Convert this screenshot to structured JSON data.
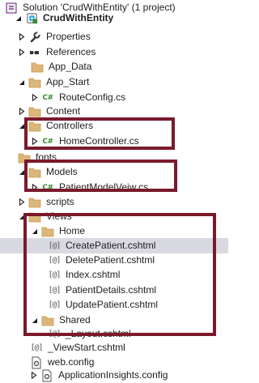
{
  "solution_explorer": {
    "nodes": [
      {
        "id": "solution",
        "label": "Solution 'CrudWithEntity' (1 project)",
        "icon": "solution-icon",
        "expander": "none",
        "bold": false,
        "selected": false
      },
      {
        "id": "project",
        "label": "CrudWithEntity",
        "icon": "web-project-icon",
        "expander": "expanded",
        "bold": true,
        "selected": false
      },
      {
        "id": "properties",
        "label": "Properties",
        "icon": "wrench-icon",
        "expander": "collapsed",
        "bold": false,
        "selected": false
      },
      {
        "id": "references",
        "label": "References",
        "icon": "references-icon",
        "expander": "collapsed",
        "bold": false,
        "selected": false
      },
      {
        "id": "app-data",
        "label": "App_Data",
        "icon": "folder-icon",
        "expander": "none",
        "bold": false,
        "selected": false
      },
      {
        "id": "app-start",
        "label": "App_Start",
        "icon": "folder-icon",
        "expander": "expanded",
        "bold": false,
        "selected": false
      },
      {
        "id": "routeconfig",
        "label": "RouteConfig.cs",
        "icon": "csharp-file-icon",
        "expander": "collapsed",
        "bold": false,
        "selected": false
      },
      {
        "id": "content",
        "label": "Content",
        "icon": "folder-icon",
        "expander": "collapsed",
        "bold": false,
        "selected": false
      },
      {
        "id": "controllers",
        "label": "Controllers",
        "icon": "folder-icon",
        "expander": "expanded",
        "bold": false,
        "selected": false
      },
      {
        "id": "homecontroller",
        "label": "HomeController.cs",
        "icon": "csharp-file-icon",
        "expander": "collapsed",
        "bold": false,
        "selected": false
      },
      {
        "id": "fonts",
        "label": "fonts",
        "icon": "folder-icon",
        "expander": "none",
        "bold": false,
        "selected": false
      },
      {
        "id": "models",
        "label": "Models",
        "icon": "folder-icon",
        "expander": "expanded",
        "bold": false,
        "selected": false
      },
      {
        "id": "patientmodelveiw",
        "label": "PatientModelVeiw.cs",
        "icon": "csharp-file-icon",
        "expander": "collapsed",
        "bold": false,
        "selected": false
      },
      {
        "id": "scripts",
        "label": "scripts",
        "icon": "folder-icon",
        "expander": "collapsed",
        "bold": false,
        "selected": false
      },
      {
        "id": "views",
        "label": "Views",
        "icon": "folder-icon",
        "expander": "expanded",
        "bold": false,
        "selected": false
      },
      {
        "id": "home",
        "label": "Home",
        "icon": "folder-icon",
        "expander": "expanded",
        "bold": false,
        "selected": false
      },
      {
        "id": "createpatient",
        "label": "CreatePatient.cshtml",
        "icon": "razor-file-icon",
        "expander": "none",
        "bold": false,
        "selected": true
      },
      {
        "id": "deletepatient",
        "label": "DeletePatient.cshtml",
        "icon": "razor-file-icon",
        "expander": "none",
        "bold": false,
        "selected": false
      },
      {
        "id": "index",
        "label": "Index.cshtml",
        "icon": "razor-file-icon",
        "expander": "none",
        "bold": false,
        "selected": false
      },
      {
        "id": "patientdetails",
        "label": "PatientDetails.cshtml",
        "icon": "razor-file-icon",
        "expander": "none",
        "bold": false,
        "selected": false
      },
      {
        "id": "updatepatient",
        "label": "UpdatePatient.cshtml",
        "icon": "razor-file-icon",
        "expander": "none",
        "bold": false,
        "selected": false
      },
      {
        "id": "shared",
        "label": "Shared",
        "icon": "folder-icon",
        "expander": "expanded",
        "bold": false,
        "selected": false
      },
      {
        "id": "layout",
        "label": "_Layout.cshtml",
        "icon": "razor-file-icon",
        "expander": "none",
        "bold": false,
        "selected": false
      },
      {
        "id": "viewstart",
        "label": "_ViewStart.cshtml",
        "icon": "razor-file-icon",
        "expander": "none",
        "bold": false,
        "selected": false
      },
      {
        "id": "webconfig",
        "label": "web.config",
        "icon": "config-file-icon",
        "expander": "none",
        "bold": false,
        "selected": false
      },
      {
        "id": "appinsights",
        "label": "ApplicationInsights.config",
        "icon": "config-file-icon",
        "expander": "collapsed",
        "bold": false,
        "selected": false
      }
    ]
  },
  "annotations": {
    "color": "#7a1a2c",
    "boxes": [
      "controllers-highlight",
      "models-highlight",
      "views-home-shared-highlight"
    ]
  },
  "colors": {
    "folder": "#dcb67a",
    "csharp": "#388a34",
    "selected_row": "#d9d9e1",
    "annotation": "#7a1a2c"
  }
}
